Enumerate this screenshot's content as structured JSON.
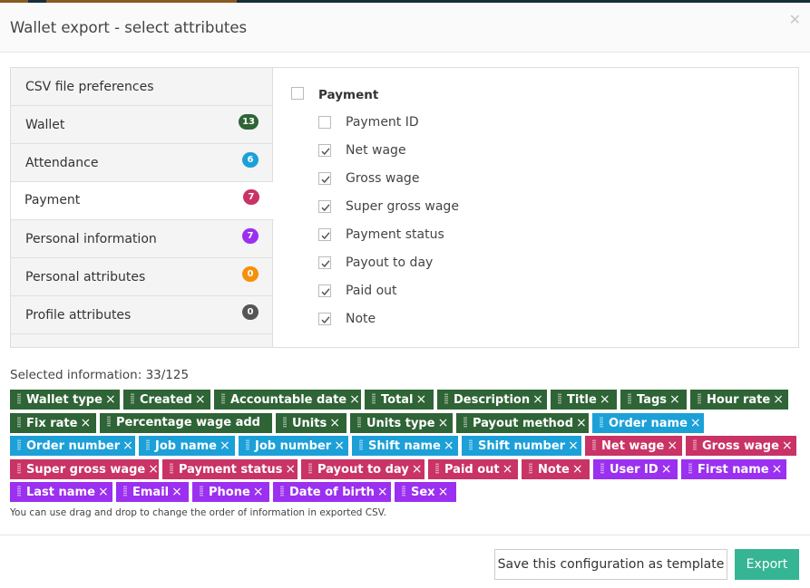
{
  "dialog": {
    "title": "Wallet export - select attributes",
    "close_icon": "close-icon"
  },
  "colors": {
    "wallet": "#2f6436",
    "attendance": "#1ca0d8",
    "payment": "#c93365",
    "personal_information": "#9b30f0",
    "personal_attributes": "#f5900a",
    "profile_attributes": "#555555",
    "export_button": "#36b594"
  },
  "sidebar": {
    "items": [
      {
        "label": "CSV file preferences",
        "badge": null,
        "color": null,
        "active": false
      },
      {
        "label": "Wallet",
        "badge": "13",
        "color": "#2f6436",
        "active": false
      },
      {
        "label": "Attendance",
        "badge": "6",
        "color": "#1ca0d8",
        "active": false
      },
      {
        "label": "Payment",
        "badge": "7",
        "color": "#c93365",
        "active": true
      },
      {
        "label": "Personal information",
        "badge": "7",
        "color": "#9b30f0",
        "active": false
      },
      {
        "label": "Personal attributes",
        "badge": "0",
        "color": "#f5900a",
        "active": false
      },
      {
        "label": "Profile attributes",
        "badge": "0",
        "color": "#555555",
        "active": false
      }
    ]
  },
  "content": {
    "group": {
      "label": "Payment",
      "checked": false
    },
    "options": [
      {
        "label": "Payment ID",
        "checked": false
      },
      {
        "label": "Net wage",
        "checked": true
      },
      {
        "label": "Gross wage",
        "checked": true
      },
      {
        "label": "Super gross wage",
        "checked": true
      },
      {
        "label": "Payment status",
        "checked": true
      },
      {
        "label": "Payout to day",
        "checked": true
      },
      {
        "label": "Paid out",
        "checked": true
      },
      {
        "label": "Note",
        "checked": true
      }
    ]
  },
  "selected": {
    "label": "Selected information: 33/125",
    "count": 33,
    "total": 125,
    "tags": [
      {
        "label": "Wallet type",
        "group": "wallet"
      },
      {
        "label": "Created",
        "group": "wallet"
      },
      {
        "label": "Accountable date",
        "group": "wallet"
      },
      {
        "label": "Total",
        "group": "wallet"
      },
      {
        "label": "Description",
        "group": "wallet"
      },
      {
        "label": "Title",
        "group": "wallet"
      },
      {
        "label": "Tags",
        "group": "wallet"
      },
      {
        "label": "Hour rate",
        "group": "wallet"
      },
      {
        "label": "Fix rate",
        "group": "wallet"
      },
      {
        "label": "Percentage wage add",
        "group": "wallet"
      },
      {
        "label": "Units",
        "group": "wallet"
      },
      {
        "label": "Units type",
        "group": "wallet"
      },
      {
        "label": "Payout method",
        "group": "wallet"
      },
      {
        "label": "Order name",
        "group": "attendance"
      },
      {
        "label": "Order number",
        "group": "attendance"
      },
      {
        "label": "Job name",
        "group": "attendance"
      },
      {
        "label": "Job number",
        "group": "attendance"
      },
      {
        "label": "Shift name",
        "group": "attendance"
      },
      {
        "label": "Shift number",
        "group": "attendance"
      },
      {
        "label": "Net wage",
        "group": "payment"
      },
      {
        "label": "Gross wage",
        "group": "payment"
      },
      {
        "label": "Super gross wage",
        "group": "payment"
      },
      {
        "label": "Payment status",
        "group": "payment"
      },
      {
        "label": "Payout to day",
        "group": "payment"
      },
      {
        "label": "Paid out",
        "group": "payment"
      },
      {
        "label": "Note",
        "group": "payment"
      },
      {
        "label": "User ID",
        "group": "personal_information"
      },
      {
        "label": "First name",
        "group": "personal_information"
      },
      {
        "label": "Last name",
        "group": "personal_information"
      },
      {
        "label": "Email",
        "group": "personal_information"
      },
      {
        "label": "Phone",
        "group": "personal_information"
      },
      {
        "label": "Date of birth",
        "group": "personal_information"
      },
      {
        "label": "Sex",
        "group": "personal_information"
      }
    ],
    "remove_glyph": "×"
  },
  "hint": "You can use drag and drop to change the order of information in exported CSV.",
  "footer": {
    "save_template_label": "Save this configuration as template",
    "export_label": "Export"
  }
}
